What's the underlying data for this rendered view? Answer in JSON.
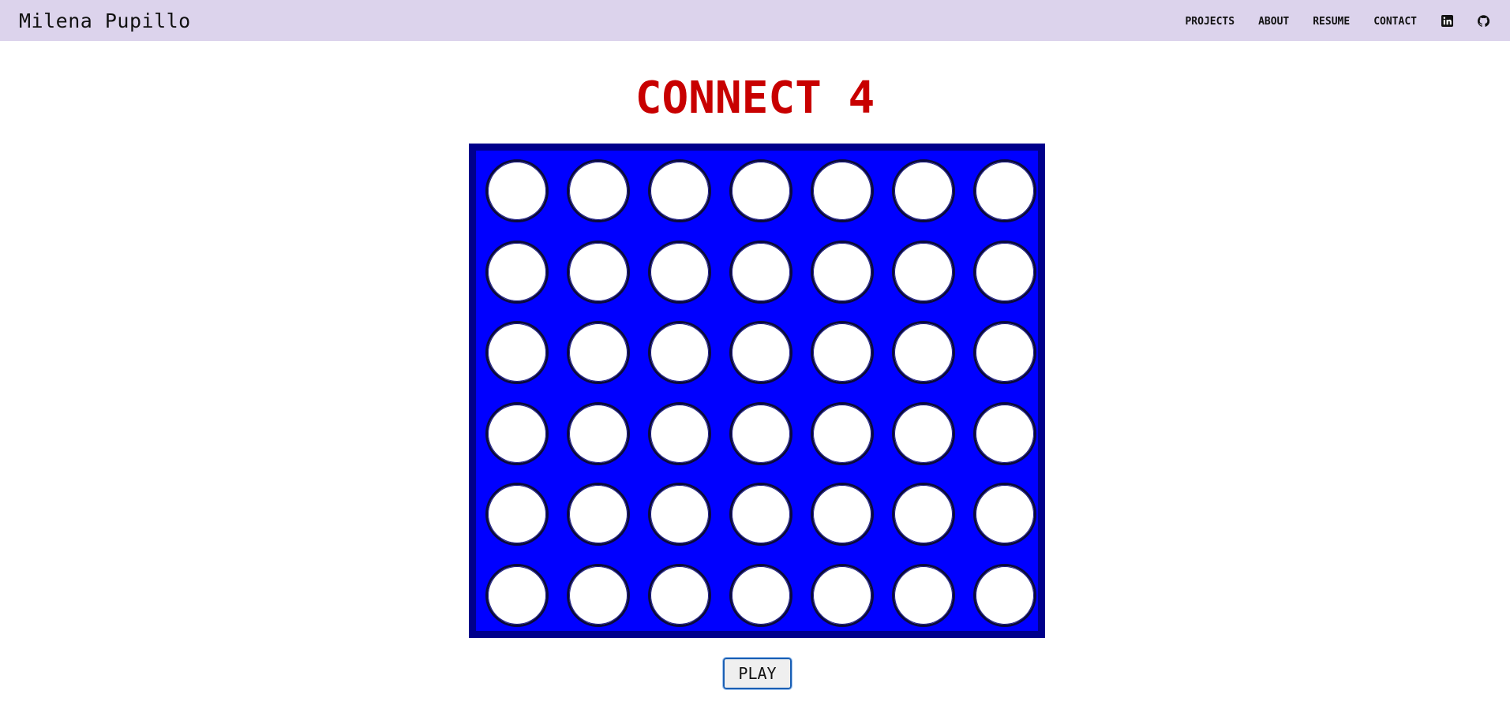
{
  "nav": {
    "brand": "Milena Pupillo",
    "links": [
      "PROJECTS",
      "ABOUT",
      "RESUME",
      "CONTACT"
    ],
    "icons": [
      "linkedin-icon",
      "github-icon"
    ],
    "background": "#dcd3ec"
  },
  "game": {
    "title": "CONNECT 4",
    "title_color": "#c80000",
    "board_color": "#0000ff",
    "board_border_color": "#00008b",
    "rows": 6,
    "columns": 7,
    "cells": [
      [
        "empty",
        "empty",
        "empty",
        "empty",
        "empty",
        "empty",
        "empty"
      ],
      [
        "empty",
        "empty",
        "empty",
        "empty",
        "empty",
        "empty",
        "empty"
      ],
      [
        "empty",
        "empty",
        "empty",
        "empty",
        "empty",
        "empty",
        "empty"
      ],
      [
        "empty",
        "empty",
        "empty",
        "empty",
        "empty",
        "empty",
        "empty"
      ],
      [
        "empty",
        "empty",
        "empty",
        "empty",
        "empty",
        "empty",
        "empty"
      ],
      [
        "empty",
        "empty",
        "empty",
        "empty",
        "empty",
        "empty",
        "empty"
      ]
    ],
    "play_label": "PLAY"
  }
}
